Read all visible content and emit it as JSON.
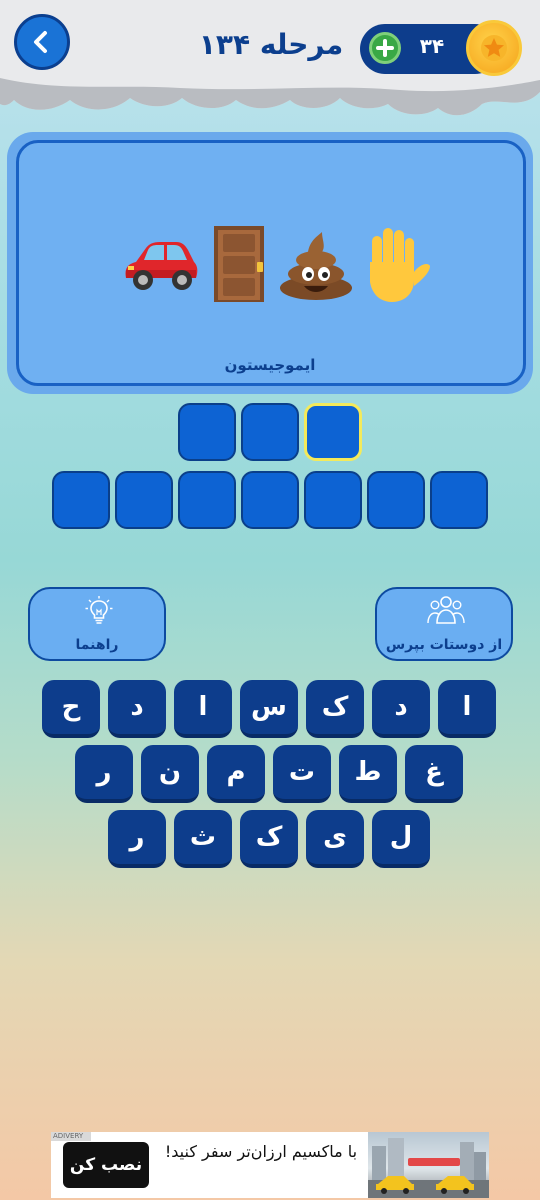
{
  "header": {
    "level_title": "مرحله ۱۳۴",
    "coins": "۳۴",
    "back_icon": "chevron-left-icon",
    "add_icon": "plus-icon",
    "star_icon": "star-icon"
  },
  "puzzle": {
    "emojis": [
      "red-car",
      "door",
      "pile-of-poo",
      "raised-hand"
    ],
    "caption": "ایموجیستون"
  },
  "answer": {
    "row1_slots": 3,
    "row2_slots": 7,
    "active_slot": "row1-3"
  },
  "hints": {
    "hint_label": "راهنما",
    "ask_friends_label": "از دوستات بپرس"
  },
  "keyboard": {
    "row1": [
      "ا",
      "د",
      "ک",
      "س",
      "ا",
      "د",
      "ح"
    ],
    "row2": [
      "غ",
      "ط",
      "ت",
      "م",
      "ن",
      "ر"
    ],
    "row3": [
      "ل",
      "ی",
      "ک",
      "ث",
      "ر"
    ]
  },
  "ad": {
    "tag": "ADIVERY",
    "text": "با ماکسیم ارزان‌تر سفر کنید!",
    "button": "نصب کن"
  },
  "colors": {
    "primary_dark": "#0d3d8c",
    "slot_blue": "#0d63d3",
    "card_blue": "#6fb0f2",
    "active_outline": "#f4ea5a",
    "coin_gold": "#f5a21a",
    "add_green": "#39a845"
  }
}
